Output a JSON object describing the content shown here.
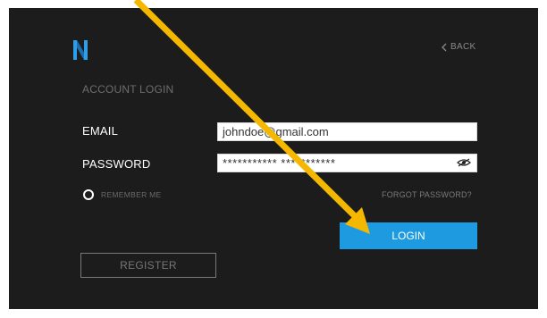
{
  "header": {
    "back_label": "BACK",
    "title": "ACCOUNT LOGIN"
  },
  "form": {
    "email_label": "EMAIL",
    "email_value": "johndoe@gmail.com",
    "password_label": "PASSWORD",
    "password_value": "*********** ***********",
    "remember_label": "REMEMBER ME",
    "forgot_label": "FORGOT PASSWORD?",
    "login_label": "LOGIN",
    "register_label": "REGISTER"
  },
  "icons": {
    "logo": "n-logo-icon",
    "back": "chevron-left-icon",
    "password_toggle": "eye-slash-icon",
    "annotation": "arrow-annotation"
  },
  "colors": {
    "panel_bg": "#1c1c1c",
    "accent": "#1e9be0",
    "logo": "#2e9ee6",
    "arrow": "#f5b800"
  }
}
